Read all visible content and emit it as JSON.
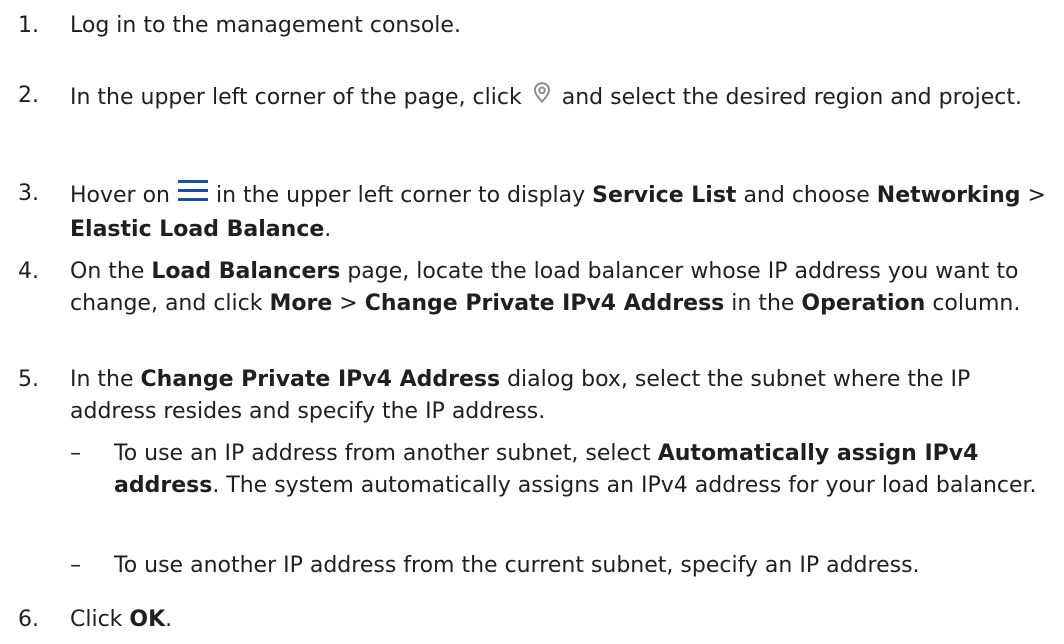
{
  "steps": [
    {
      "num": "1.",
      "text": "Log in to the management console."
    },
    {
      "num": "2.",
      "before": "In the upper left corner of the page, click",
      "icon": "location-pin-icon",
      "after": "and select the desired region and project."
    },
    {
      "num": "3.",
      "before": "Hover on",
      "icon": "hamburger-menu-icon",
      "mid": "in the upper left corner to display",
      "b1": "Service List",
      "mid2": "and choose",
      "b2": "Networking",
      "sep": ">",
      "b3": "Elastic Load Balance",
      "end": "."
    },
    {
      "num": "4.",
      "pre": "On the",
      "b1": "Load Balancers",
      "mid": "page, locate the load balancer whose IP address you want to change, and click",
      "b2": "More",
      "sep": ">",
      "b3": "Change Private IPv4 Address",
      "mid2": "in the",
      "b4": "Operation",
      "end": "column."
    },
    {
      "num": "5.",
      "pre": "In the",
      "b1": "Change Private IPv4 Address",
      "end": "dialog box, select the subnet where the IP address resides and specify the IP address."
    },
    {
      "num": "6.",
      "pre": "Click",
      "b1": "OK",
      "end": "."
    }
  ],
  "substeps": [
    {
      "dash": "–",
      "pre": "To use an IP address from another subnet, select",
      "b1": "Automatically assign IPv4 address",
      "end": ". The system automatically assigns an IPv4 address for your load balancer."
    },
    {
      "dash": "–",
      "text": "To use another IP address from the current subnet, specify an IP address."
    }
  ],
  "colors": {
    "text": "#1f1f1f",
    "icon": "#8a8a8a",
    "menu_icon": "#1f4e96"
  }
}
